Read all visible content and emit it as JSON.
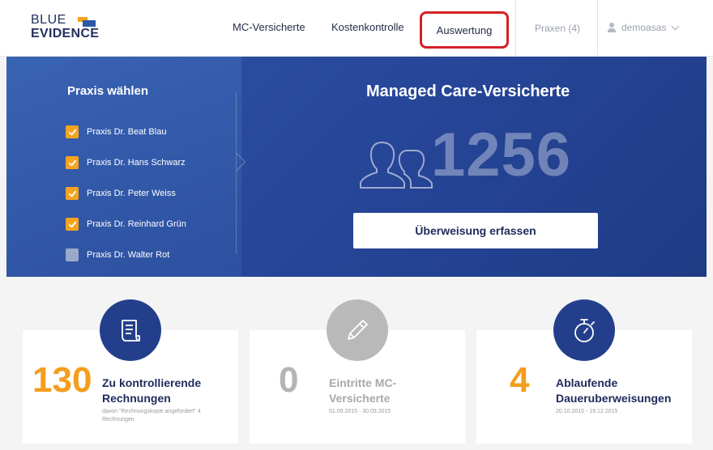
{
  "header": {
    "logo_line1": "BLUE",
    "logo_line2": "EVIDENCE",
    "nav": {
      "mc_versicherte": "MC-Versicherte",
      "kostenkontrolle": "Kostenkontrolle",
      "auswertung": "Auswertung",
      "praxen": "Praxen (4)",
      "user": "demoasas"
    }
  },
  "hero": {
    "praxis_title": "Praxis wählen",
    "praxen": [
      {
        "label": "Praxis Dr. Beat Blau",
        "checked": true
      },
      {
        "label": "Praxis Dr. Hans Schwarz",
        "checked": true
      },
      {
        "label": "Praxis Dr. Peter Weiss",
        "checked": true
      },
      {
        "label": "Praxis Dr. Reinhard Grün",
        "checked": true
      },
      {
        "label": "Praxis Dr. Walter Rot",
        "checked": false
      }
    ],
    "mc_title": "Managed Care-Versicherte",
    "mc_count": "1256",
    "button_label": "Überweisung erfassen"
  },
  "cards": [
    {
      "number": "130",
      "title_line1": "Zu kontrollierende",
      "title_line2": "Rechnungen",
      "sub": "davon \"Rechnungskopie angefordert\" 4 Rechnungen",
      "icon": "invoice-icon"
    },
    {
      "number": "0",
      "title_line1": "Eintritte MC-",
      "title_line2": "Versicherte",
      "sub": "01.09.2015 - 30.09.2015",
      "icon": "pencil-icon"
    },
    {
      "number": "4",
      "title_line1": "Ablaufende",
      "title_line2": "Daueruberweisungen",
      "sub": "20.10.2015 - 19.12.2015",
      "icon": "stopwatch-icon"
    }
  ],
  "colors": {
    "accent_orange": "#f59d1e",
    "brand_blue": "#233f8c",
    "highlight_red": "#d61f26"
  }
}
